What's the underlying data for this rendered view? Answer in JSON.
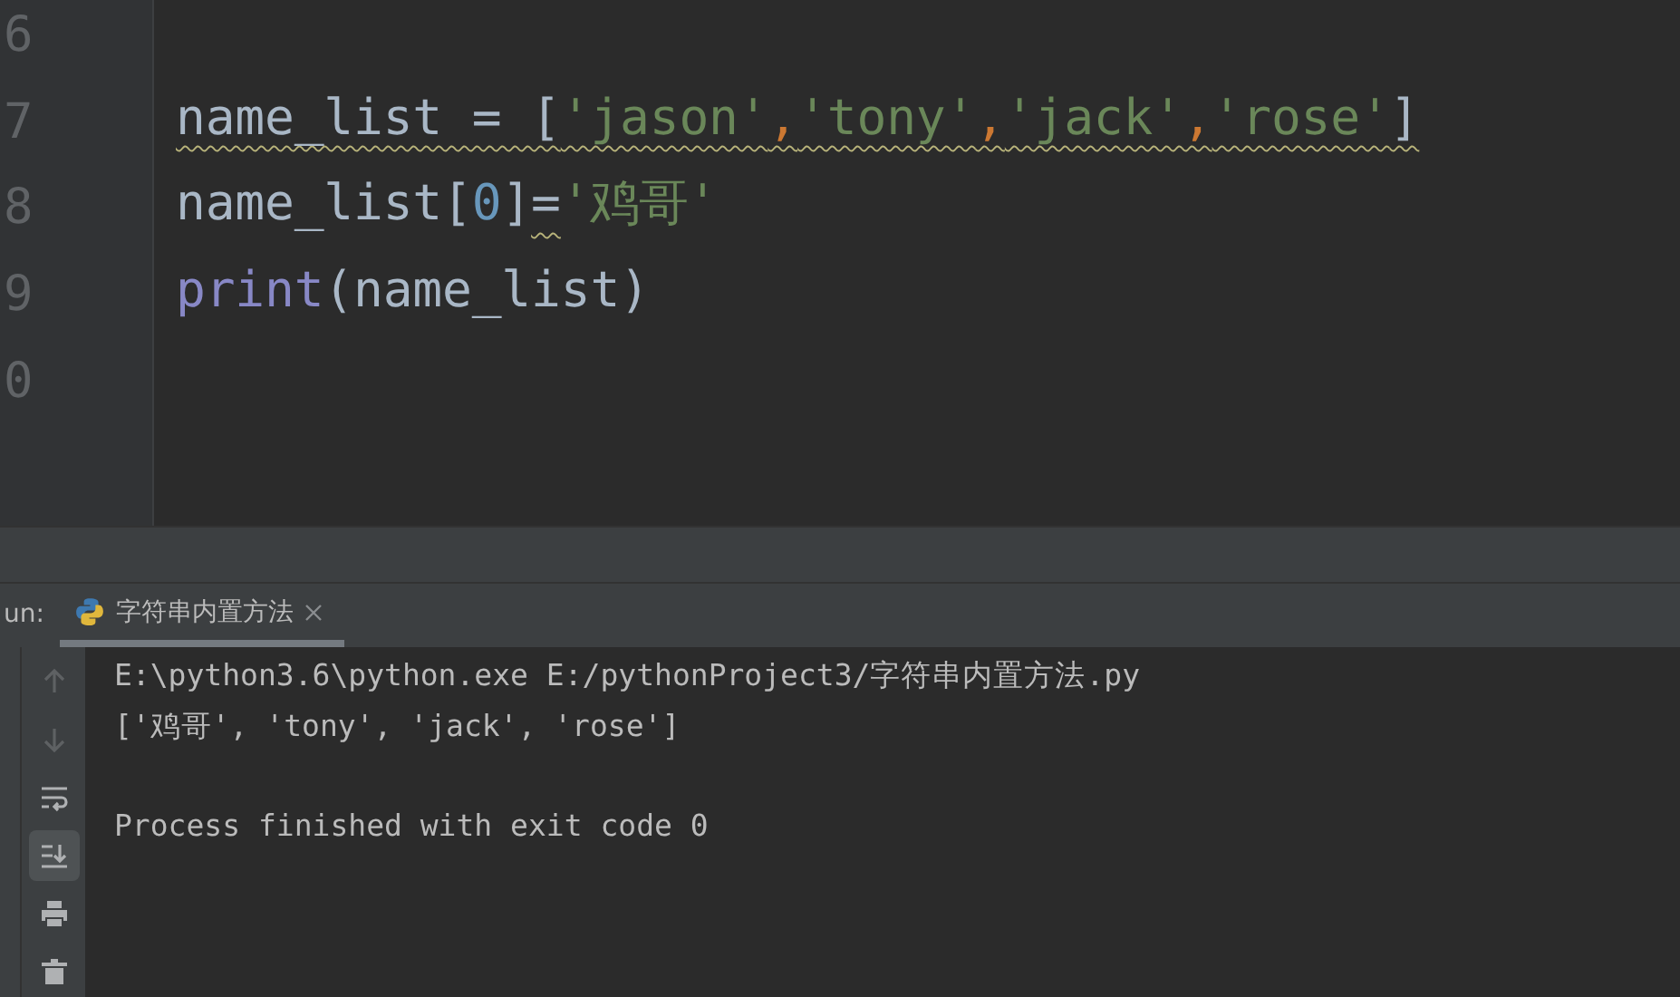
{
  "editor": {
    "lines": [
      {
        "number": "6"
      },
      {
        "number": "7",
        "tokens": [
          {
            "kind": "ident",
            "text": "name_list",
            "squiggle": true
          },
          {
            "kind": "op",
            "text": " = ",
            "squiggle": true
          },
          {
            "kind": "bracket",
            "text": "[",
            "squiggle": true
          },
          {
            "kind": "string",
            "text": "'jason'",
            "squiggle": true
          },
          {
            "kind": "comma",
            "text": ",",
            "squiggle": true
          },
          {
            "kind": "string",
            "text": "'tony'",
            "squiggle": true
          },
          {
            "kind": "comma",
            "text": ",",
            "squiggle": true
          },
          {
            "kind": "string",
            "text": "'jack'",
            "squiggle": true
          },
          {
            "kind": "comma",
            "text": ",",
            "squiggle": true
          },
          {
            "kind": "string",
            "text": "'rose'",
            "squiggle": true
          },
          {
            "kind": "bracket",
            "text": "]",
            "squiggle": true
          }
        ]
      },
      {
        "number": "8",
        "tokens": [
          {
            "kind": "ident",
            "text": "name_list",
            "squiggle": false
          },
          {
            "kind": "bracket",
            "text": "[",
            "squiggle": false
          },
          {
            "kind": "number",
            "text": "0",
            "squiggle": false
          },
          {
            "kind": "bracket",
            "text": "]",
            "squiggle": false
          },
          {
            "kind": "op",
            "text": "=",
            "squiggle": true
          },
          {
            "kind": "string",
            "text": "'鸡哥'",
            "squiggle": false
          }
        ]
      },
      {
        "number": "9",
        "tokens": [
          {
            "kind": "builtin",
            "text": "print",
            "squiggle": false
          },
          {
            "kind": "op",
            "text": "(",
            "squiggle": false
          },
          {
            "kind": "ident",
            "text": "name_list",
            "squiggle": false
          },
          {
            "kind": "op",
            "text": ")",
            "squiggle": false
          }
        ]
      },
      {
        "number": "0"
      }
    ]
  },
  "run_panel": {
    "label": "un:",
    "tabs": [
      {
        "label": "字符串内置方法",
        "selected": true
      }
    ],
    "toolbar": [
      {
        "kind": "up",
        "selected": false
      },
      {
        "kind": "down",
        "selected": false
      },
      {
        "kind": "wrap",
        "selected": false
      },
      {
        "kind": "scroll-end",
        "selected": true
      },
      {
        "kind": "print",
        "selected": false
      },
      {
        "kind": "trash",
        "selected": false
      }
    ],
    "console": [
      "E:\\python3.6\\python.exe E:/pythonProject3/字符串内置方法.py",
      "['鸡哥', 'tony', 'jack', 'rose']",
      "Process finished with exit code 0"
    ]
  }
}
